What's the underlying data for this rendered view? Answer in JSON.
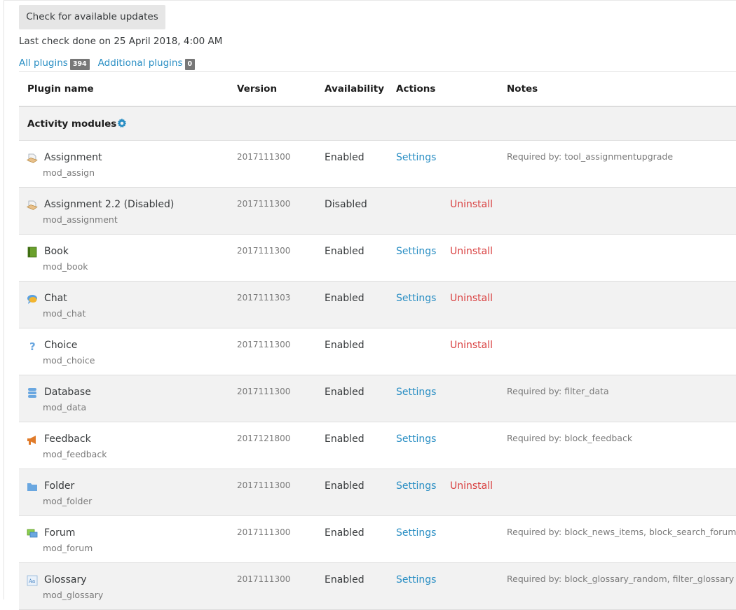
{
  "toolbar": {
    "check_updates_label": "Check for available updates",
    "last_check_text": "Last check done on 25 April 2018, 4:00 AM"
  },
  "filters": {
    "all_label": "All plugins",
    "all_count": "394",
    "additional_label": "Additional plugins",
    "additional_count": "0"
  },
  "table": {
    "headers": {
      "plugin_name": "Plugin name",
      "version": "Version",
      "availability": "Availability",
      "actions": "Actions",
      "notes": "Notes"
    },
    "section_title": "Activity modules",
    "rows": [
      {
        "name": "Assignment",
        "component": "mod_assign",
        "version": "2017111300",
        "availability": "Enabled",
        "settings": "Settings",
        "uninstall": "",
        "notes": "Required by: tool_assignmentupgrade",
        "icon": "assignment-icon"
      },
      {
        "name": "Assignment 2.2 (Disabled)",
        "component": "mod_assignment",
        "version": "2017111300",
        "availability": "Disabled",
        "settings": "",
        "uninstall": "Uninstall",
        "notes": "",
        "icon": "assignment-icon"
      },
      {
        "name": "Book",
        "component": "mod_book",
        "version": "2017111300",
        "availability": "Enabled",
        "settings": "Settings",
        "uninstall": "Uninstall",
        "notes": "",
        "icon": "book-icon"
      },
      {
        "name": "Chat",
        "component": "mod_chat",
        "version": "2017111303",
        "availability": "Enabled",
        "settings": "Settings",
        "uninstall": "Uninstall",
        "notes": "",
        "icon": "chat-icon"
      },
      {
        "name": "Choice",
        "component": "mod_choice",
        "version": "2017111300",
        "availability": "Enabled",
        "settings": "",
        "uninstall": "Uninstall",
        "notes": "",
        "icon": "question-mark-icon"
      },
      {
        "name": "Database",
        "component": "mod_data",
        "version": "2017111300",
        "availability": "Enabled",
        "settings": "Settings",
        "uninstall": "",
        "notes": "Required by: filter_data",
        "icon": "database-icon"
      },
      {
        "name": "Feedback",
        "component": "mod_feedback",
        "version": "2017121800",
        "availability": "Enabled",
        "settings": "Settings",
        "uninstall": "",
        "notes": "Required by: block_feedback",
        "icon": "megaphone-icon"
      },
      {
        "name": "Folder",
        "component": "mod_folder",
        "version": "2017111300",
        "availability": "Enabled",
        "settings": "Settings",
        "uninstall": "Uninstall",
        "notes": "",
        "icon": "folder-icon"
      },
      {
        "name": "Forum",
        "component": "mod_forum",
        "version": "2017111300",
        "availability": "Enabled",
        "settings": "Settings",
        "uninstall": "",
        "notes": "Required by: block_news_items, block_search_forums",
        "icon": "forum-icon"
      },
      {
        "name": "Glossary",
        "component": "mod_glossary",
        "version": "2017111300",
        "availability": "Enabled",
        "settings": "Settings",
        "uninstall": "",
        "notes": "Required by: block_glossary_random, filter_glossary",
        "icon": "glossary-icon"
      }
    ]
  },
  "colors": {
    "link": "#2b8fc4",
    "uninstall": "#d94040",
    "muted": "#7a7a7a",
    "badge": "#777777"
  }
}
